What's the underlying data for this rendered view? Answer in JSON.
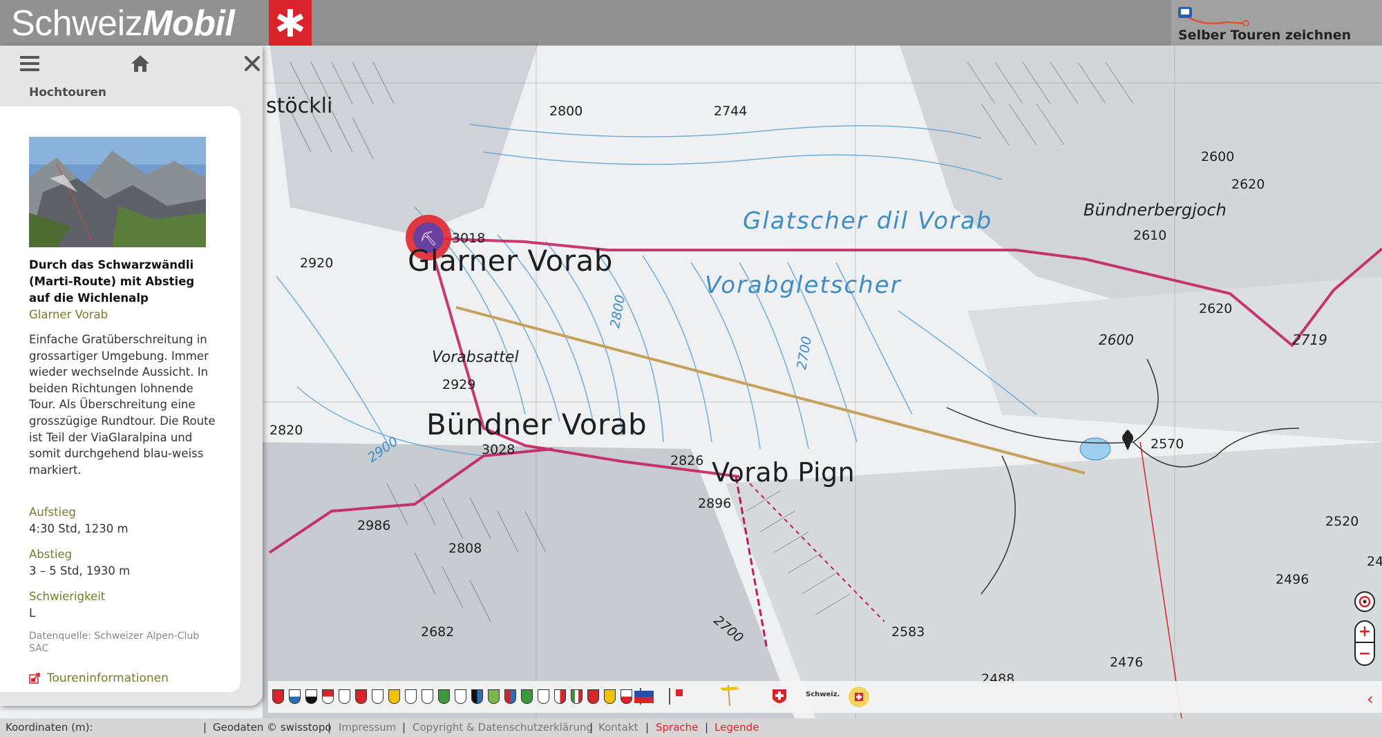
{
  "header": {
    "logo_regular": "Schweiz",
    "logo_bold": "Mobil",
    "draw_tours_label": "Selber Touren zeichnen"
  },
  "panel": {
    "heading": "Hochtouren",
    "tour": {
      "title": "Durch das Schwarzwändli (Marti-Route) mit Abstieg auf die Wichlenalp",
      "region": "Glarner Vorab",
      "description": "Einfache Gratüberschreitung in grossartiger Umgebung. Immer wieder wechselnde Aussicht. In beiden Richtungen lohnende Tour. Als Überschreitung eine grosszügige Rundtour. Die Route ist Teil der ViaGlaralpina und somit durchgehend blau-weiss markiert.",
      "facts": [
        {
          "label": "Aufstieg",
          "value": "4:30 Std, 1230 m"
        },
        {
          "label": "Abstieg",
          "value": "3 – 5 Std, 1930 m"
        },
        {
          "label": "Schwierigkeit",
          "value": "L"
        }
      ],
      "source": "Datenquelle: Schweizer Alpen-Club SAC",
      "info_link": "Toureninformationen"
    }
  },
  "map": {
    "labels": {
      "stoeckli": "stöckli",
      "glarner_vorab": "Glarner Vorab",
      "buendner_vorab": "Bündner Vorab",
      "vorab_pign": "Vorab Pign",
      "glatscher": "Glatscher dil Vorab",
      "vorabgletscher": "Vorabgletscher",
      "vorabsattel": "Vorabsattel",
      "buendnerbergjoch": "Bündnerbergjoch"
    },
    "elevations": {
      "e2800": "2800",
      "e2744": "2744",
      "e3018": "3018",
      "e2920": "2920",
      "e2929": "2929",
      "e2820": "2820",
      "e3028": "3028",
      "e2826": "2826",
      "e2896": "2896",
      "e2986": "2986",
      "e2808": "2808",
      "e2682": "2682",
      "e2583": "2583",
      "e2600t": "2600",
      "e2620t": "2620",
      "e2610": "2610",
      "e2620": "2620",
      "e2600": "2600",
      "e2719": "2719",
      "e2570": "2570",
      "e2520": "2520",
      "e2496": "2496",
      "e2476": "2476",
      "e2488": "2488",
      "e24": "24"
    },
    "contours": {
      "c2800": "2800",
      "c2700": "2700",
      "c2900": "2900",
      "c2700b": "2700"
    }
  },
  "controls": {
    "zoom_in": "+",
    "zoom_out": "−"
  },
  "footer": {
    "coords_label": "Koordinaten (m):",
    "geodata": "Geodaten © swisstopo",
    "impressum": "Impressum",
    "copyright": "Copyright & Datenschutzerklärung",
    "kontakt": "Kontakt",
    "sprache": "Sprache",
    "legende": "Legende"
  },
  "partners": {
    "schweiz_logo": "Schweiz."
  },
  "colors": {
    "brand_red": "#d8232a",
    "route_pink": "#c2185b",
    "glacier_blue": "#3d8cc4",
    "region_olive": "#7a7a2a"
  }
}
